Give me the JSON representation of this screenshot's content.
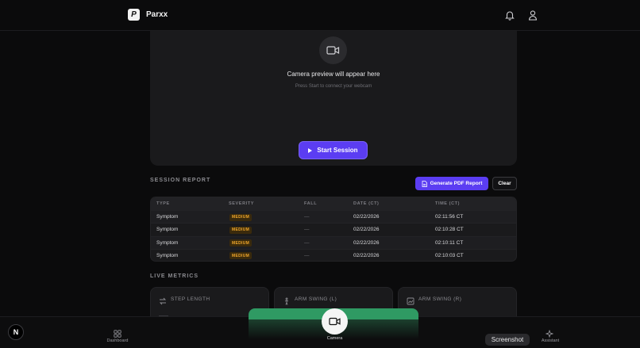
{
  "header": {
    "logo_text": "P",
    "brand": "Parxx",
    "bell_icon": "bell-icon",
    "user_icon": "user-icon"
  },
  "camera": {
    "icon": "video-camera-icon",
    "title": "Camera preview will appear here",
    "subtitle": "Press Start to connect your webcam",
    "start_label": "Start Session"
  },
  "report": {
    "section_label": "SESSION REPORT",
    "pdf_label": "Generate PDF Report",
    "clear_label": "Clear",
    "columns": [
      "TYPE",
      "SEVERITY",
      "FALL",
      "DATE (CT)",
      "TIME (CT)"
    ],
    "rows": [
      {
        "type": "Symptom",
        "severity": "MEDIUM",
        "fall": "—",
        "date": "02/22/2026",
        "time": "02:11:56 CT"
      },
      {
        "type": "Symptom",
        "severity": "MEDIUM",
        "fall": "—",
        "date": "02/22/2026",
        "time": "02:10:28 CT"
      },
      {
        "type": "Symptom",
        "severity": "MEDIUM",
        "fall": "—",
        "date": "02/22/2026",
        "time": "02:10:11 CT"
      },
      {
        "type": "Symptom",
        "severity": "MEDIUM",
        "fall": "—",
        "date": "02/22/2026",
        "time": "02:10:03 CT"
      }
    ]
  },
  "metrics": {
    "section_label": "LIVE METRICS",
    "cards": [
      {
        "label": "STEP LENGTH",
        "icon": "arrows-swap-icon"
      },
      {
        "label": "ARM SWING (L)",
        "icon": "activity-icon"
      },
      {
        "label": "ARM SWING (R)",
        "icon": "chart-icon"
      }
    ]
  },
  "nav": {
    "n_badge": "N",
    "dashboard_label": "Dashboard",
    "camera_label": "Camera",
    "assistant_label": "Assistant",
    "screenshot_label": "Screenshot"
  },
  "colors": {
    "accent": "#5b3df2",
    "badge_medium": "#f0a72b",
    "camera_active": "#2f9a63"
  }
}
